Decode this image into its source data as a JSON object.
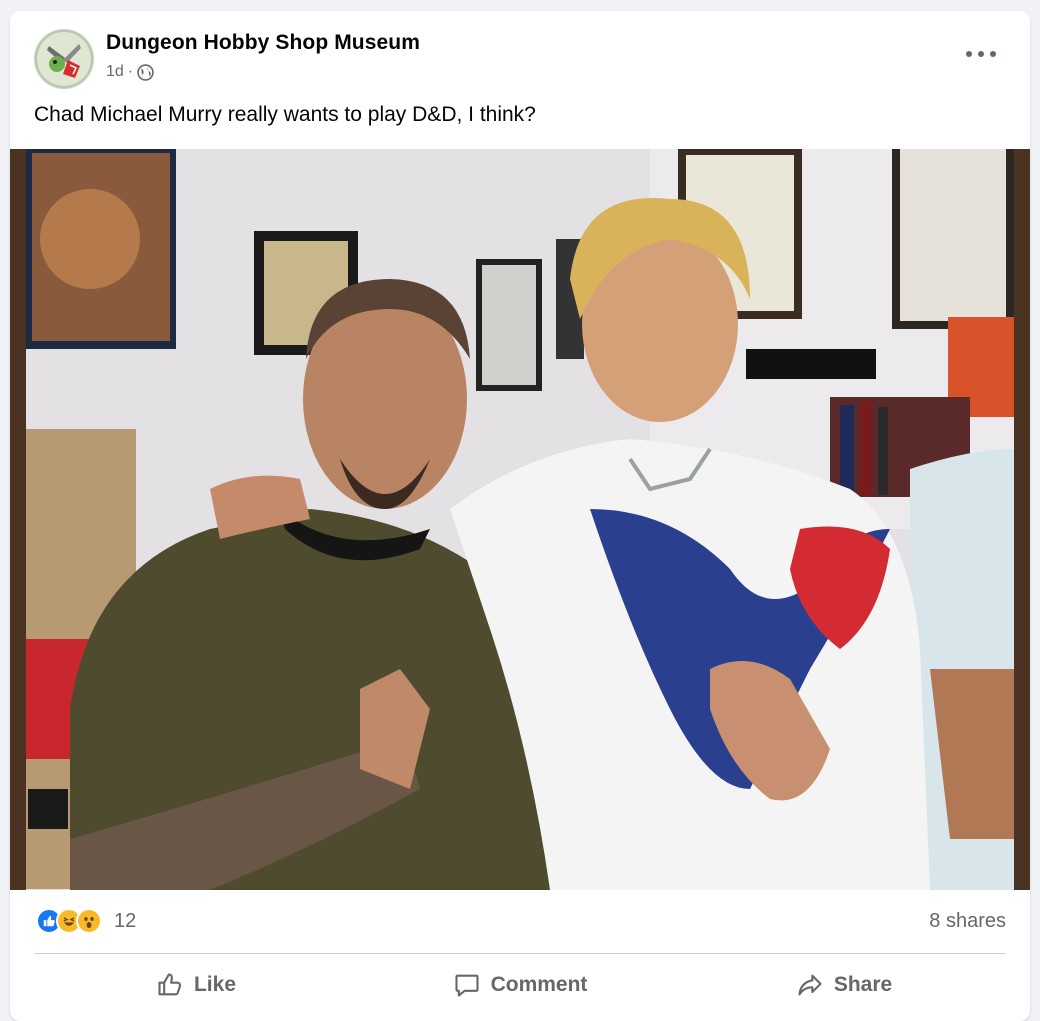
{
  "post": {
    "author": "Dungeon Hobby Shop Museum",
    "time": "1d",
    "separator": "·",
    "privacy_icon": "globe-icon",
    "caption": "Chad Michael Murry really wants to play D&D, I think?"
  },
  "reactions": {
    "icons": [
      "like-icon",
      "haha-icon",
      "wow-icon"
    ],
    "count": "12",
    "shares": "8 shares"
  },
  "actions": {
    "like": "Like",
    "comment": "Comment",
    "share": "Share"
  },
  "colors": {
    "like_blue": "#1877f2",
    "reaction_yellow": "#f7b928",
    "secondary_text": "#65676b"
  }
}
